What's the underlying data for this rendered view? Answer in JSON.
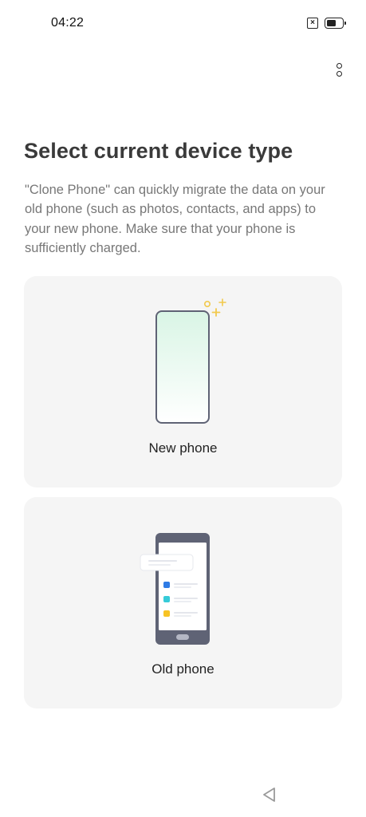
{
  "status_bar": {
    "time": "04:22",
    "icons": [
      "sim-disabled-icon",
      "battery-icon"
    ]
  },
  "header": {
    "menu_icon": "more-vertical-icon"
  },
  "main": {
    "title": "Select current device type",
    "description": "\"Clone Phone\" can quickly migrate the data on your old phone (such as photos, contacts, and apps) to your new phone. Make sure that your phone is sufficiently charged.",
    "options": [
      {
        "label": "New phone",
        "icon": "new-phone-illustration"
      },
      {
        "label": "Old phone",
        "icon": "old-phone-illustration"
      }
    ]
  },
  "colors": {
    "card_background": "#f5f5f5",
    "title": "#3a3a3a",
    "description": "#777777",
    "new_phone_screen_top": "#d9f5e5",
    "sparkle": "#f2c94c",
    "old_phone_body": "#5f6375",
    "app_blue": "#2f7be5",
    "app_teal": "#36cbd8",
    "app_yellow": "#f7c325"
  }
}
